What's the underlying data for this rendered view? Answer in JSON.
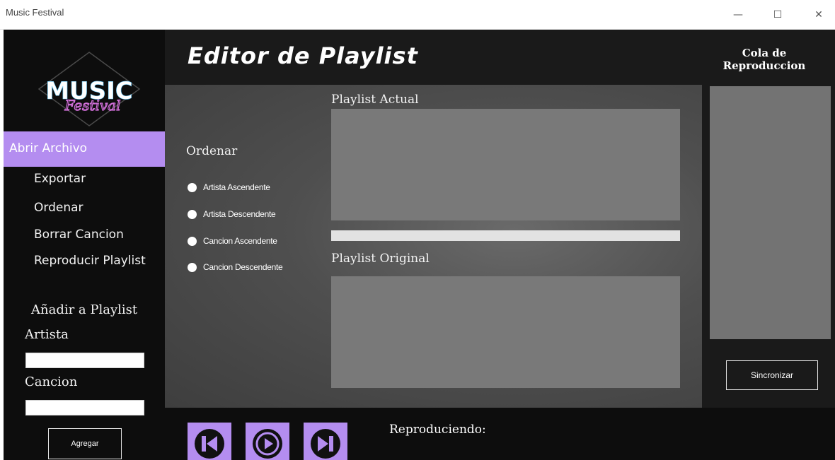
{
  "window": {
    "title": "Music Festival",
    "minimize_glyph": "—",
    "maximize_glyph": "☐",
    "close_glyph": "✕"
  },
  "logo": {
    "text": "MUSIC",
    "subtext": "Festival"
  },
  "sidebar": {
    "active_item": "Abrir Archivo",
    "items": [
      "Exportar",
      "Ordenar",
      "Borrar Cancion",
      "Reproducir Playlist"
    ],
    "add_section_title": "Añadir a Playlist",
    "artist_label": "Artista",
    "artist_value": "",
    "song_label": "Cancion",
    "song_value": "",
    "add_button": "Agregar"
  },
  "header": {
    "title": "Editor de Playlist",
    "queue_title": "Cola de Reproduccion"
  },
  "sort": {
    "title": "Ordenar",
    "options": [
      "Artista Ascendente",
      "Artista Descendente",
      "Cancion Ascendente",
      "Cancion Descendente"
    ]
  },
  "playlists": {
    "current_title": "Playlist Actual",
    "original_title": "Playlist Original",
    "progress": 0
  },
  "queue": {
    "sync_button": "Sincronizar"
  },
  "player": {
    "controls": [
      "previous-icon",
      "play-icon",
      "next-icon"
    ],
    "now_playing_label": "Reproduciendo:"
  },
  "colors": {
    "accent": "#b48df0",
    "sidebar_bg": "#0d0d0d",
    "panel_bg": "#1a1a1a"
  }
}
